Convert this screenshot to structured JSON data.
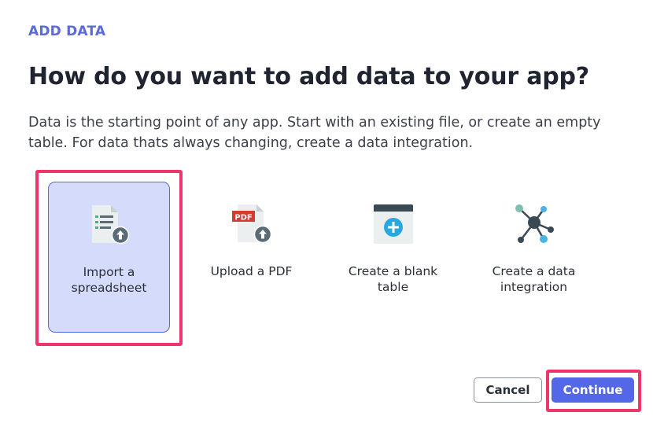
{
  "header": {
    "eyebrow": "ADD DATA",
    "title": "How do you want to add data to your app?",
    "description": "Data is the starting point of any app. Start with an existing file, or create an empty table. For data thats always changing, create a data integration."
  },
  "options": [
    {
      "label": "Import a spreadsheet",
      "icon": "spreadsheet-upload-icon",
      "selected": true
    },
    {
      "label": "Upload a PDF",
      "icon": "pdf-upload-icon",
      "selected": false
    },
    {
      "label": "Create a blank table",
      "icon": "blank-table-icon",
      "selected": false
    },
    {
      "label": "Create a data integration",
      "icon": "data-integration-icon",
      "selected": false
    }
  ],
  "icon_text": {
    "pdf_badge": "PDF"
  },
  "footer": {
    "cancel_label": "Cancel",
    "continue_label": "Continue"
  },
  "colors": {
    "accent": "#5468e7",
    "eyebrow": "#5b6ad9",
    "selected_bg": "#d4dbfb",
    "highlight": "#f0356b",
    "icon_gray": "#5a6b76",
    "pdf_red": "#d63b30",
    "integration_teal": "#7fbfb0",
    "integration_blue": "#48b4e6"
  }
}
